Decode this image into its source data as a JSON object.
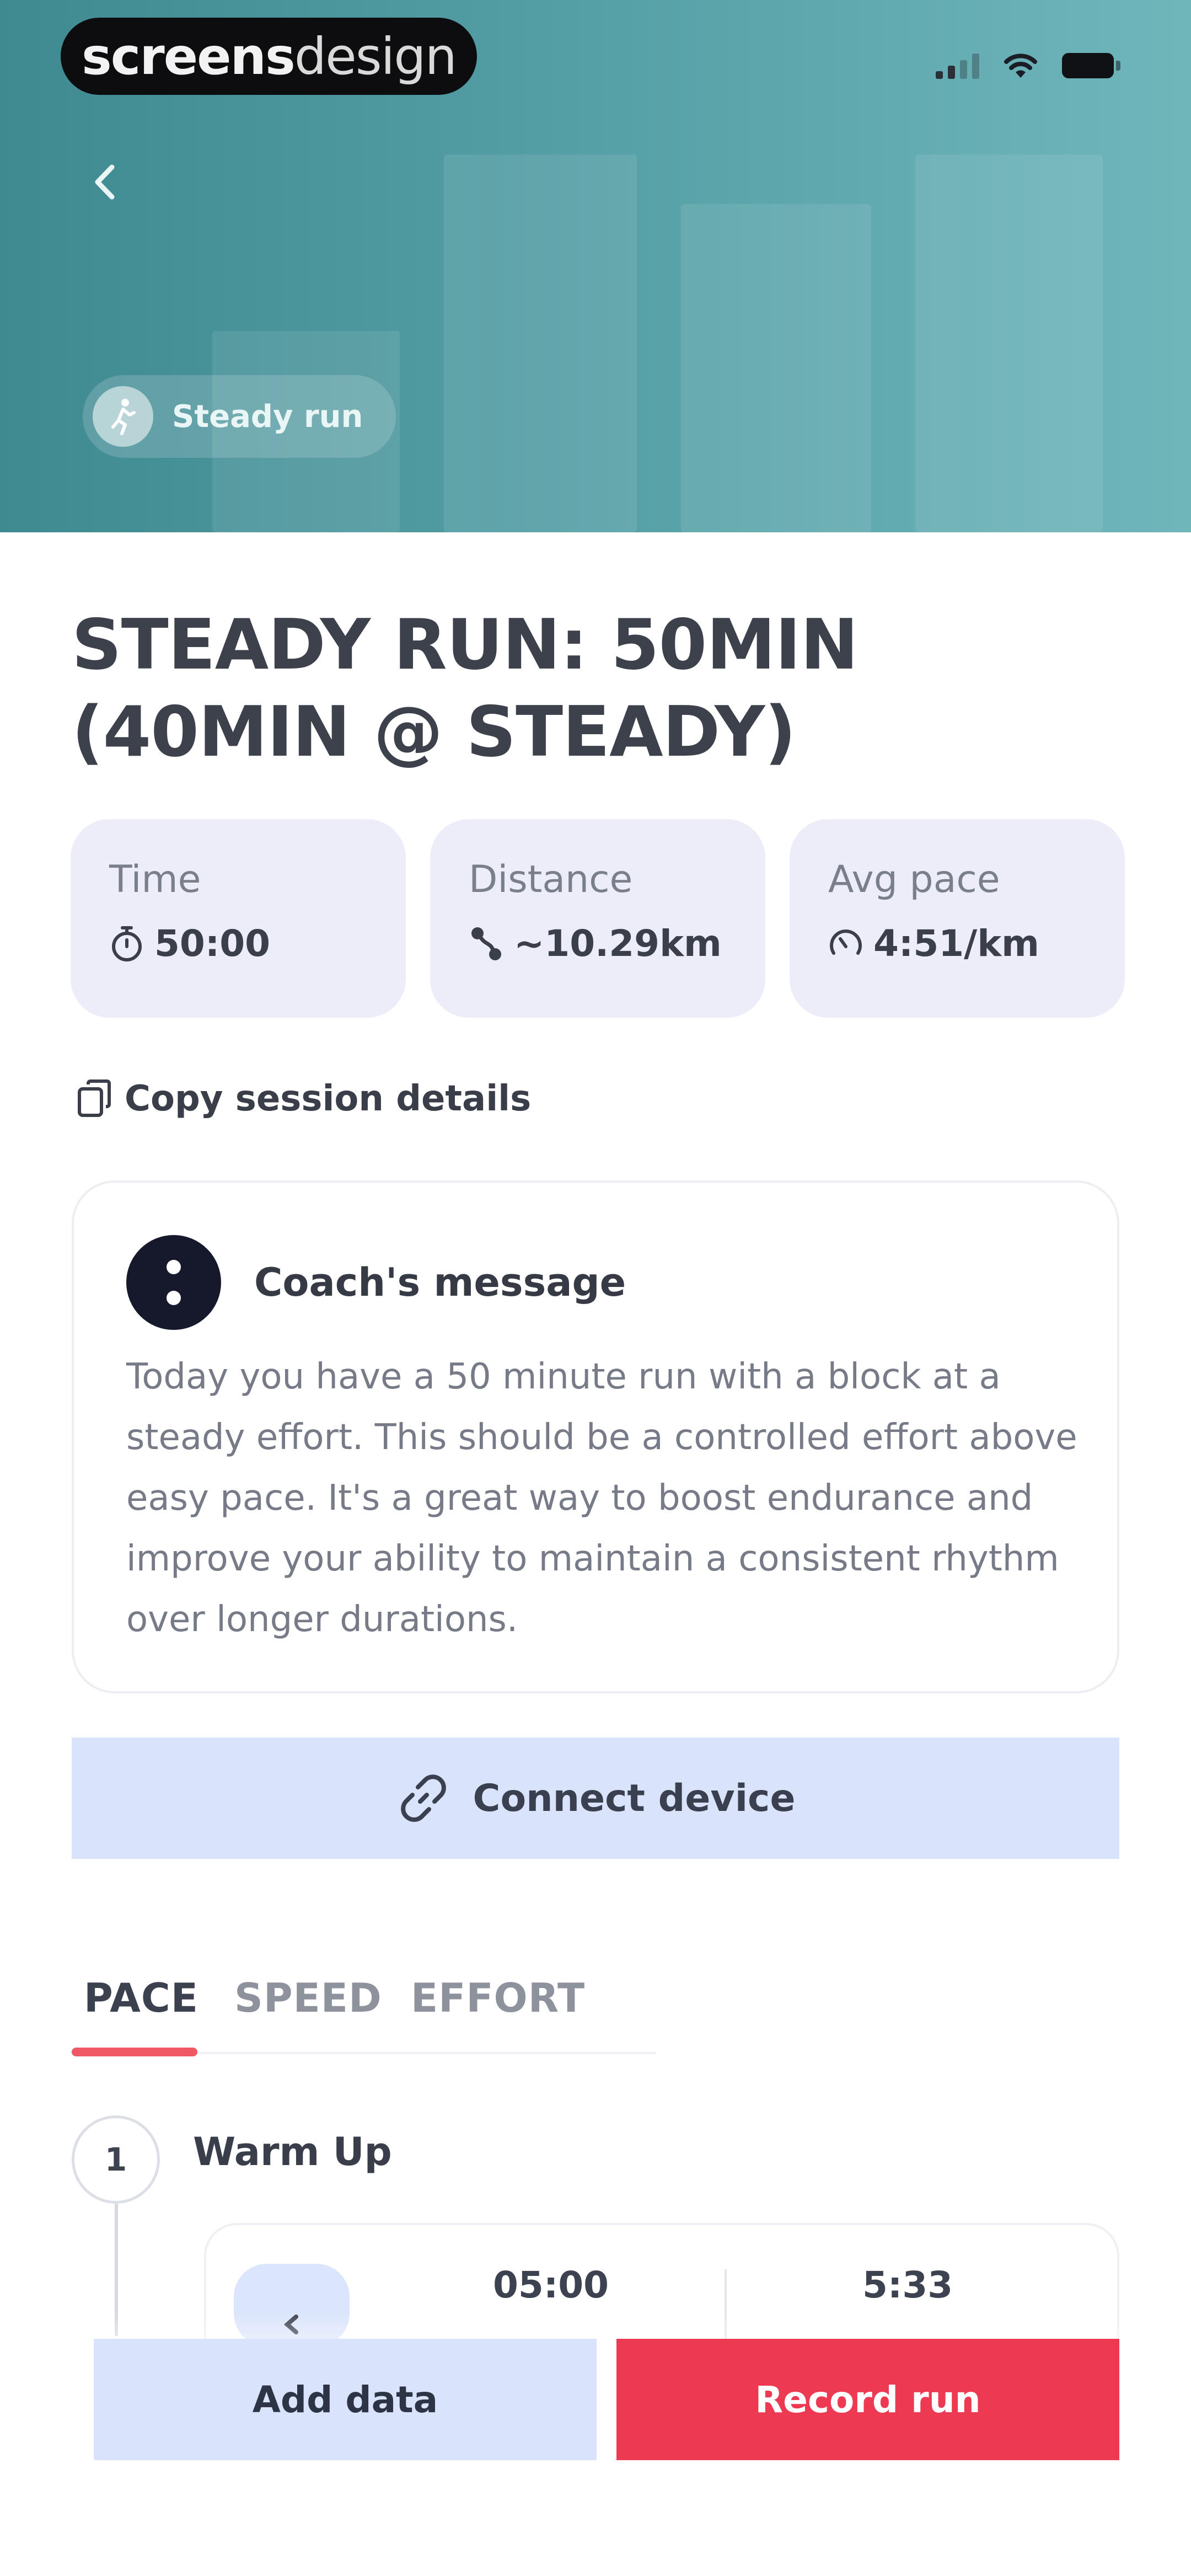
{
  "brand": {
    "bold": "screens",
    "thin": "design"
  },
  "hero": {
    "tag_label": "Steady run"
  },
  "session": {
    "title": "STEADY RUN: 50MIN (40MIN @ STEADY)",
    "stats": [
      {
        "label": "Time",
        "value": "50:00",
        "icon": "stopwatch-icon"
      },
      {
        "label": "Distance",
        "value": "~10.29km",
        "icon": "route-icon"
      },
      {
        "label": "Avg pace",
        "value": "4:51/km",
        "icon": "speedometer-icon"
      }
    ],
    "copy_label": "Copy session details"
  },
  "coach": {
    "title": "Coach's message",
    "message": "Today you have a 50 minute run with a block at a steady effort. This should be a controlled effort above easy pace. It's a great way to boost endurance and improve your ability to maintain a consistent rhythm over longer durations."
  },
  "connect_label": "Connect device",
  "tabs": [
    {
      "label": "PACE",
      "active": true
    },
    {
      "label": "SPEED",
      "active": false
    },
    {
      "label": "EFFORT",
      "active": false
    }
  ],
  "steps": [
    {
      "number": "1",
      "title": "Warm Up",
      "duration": "05:00",
      "pace": "5:33"
    }
  ],
  "actions": {
    "add_data": "Add data",
    "record_run": "Record run"
  },
  "colors": {
    "accent": "#EE3952",
    "hero": "#55A0A6",
    "soft_blue": "#D9E3FB",
    "card": "#ECEDF9"
  }
}
